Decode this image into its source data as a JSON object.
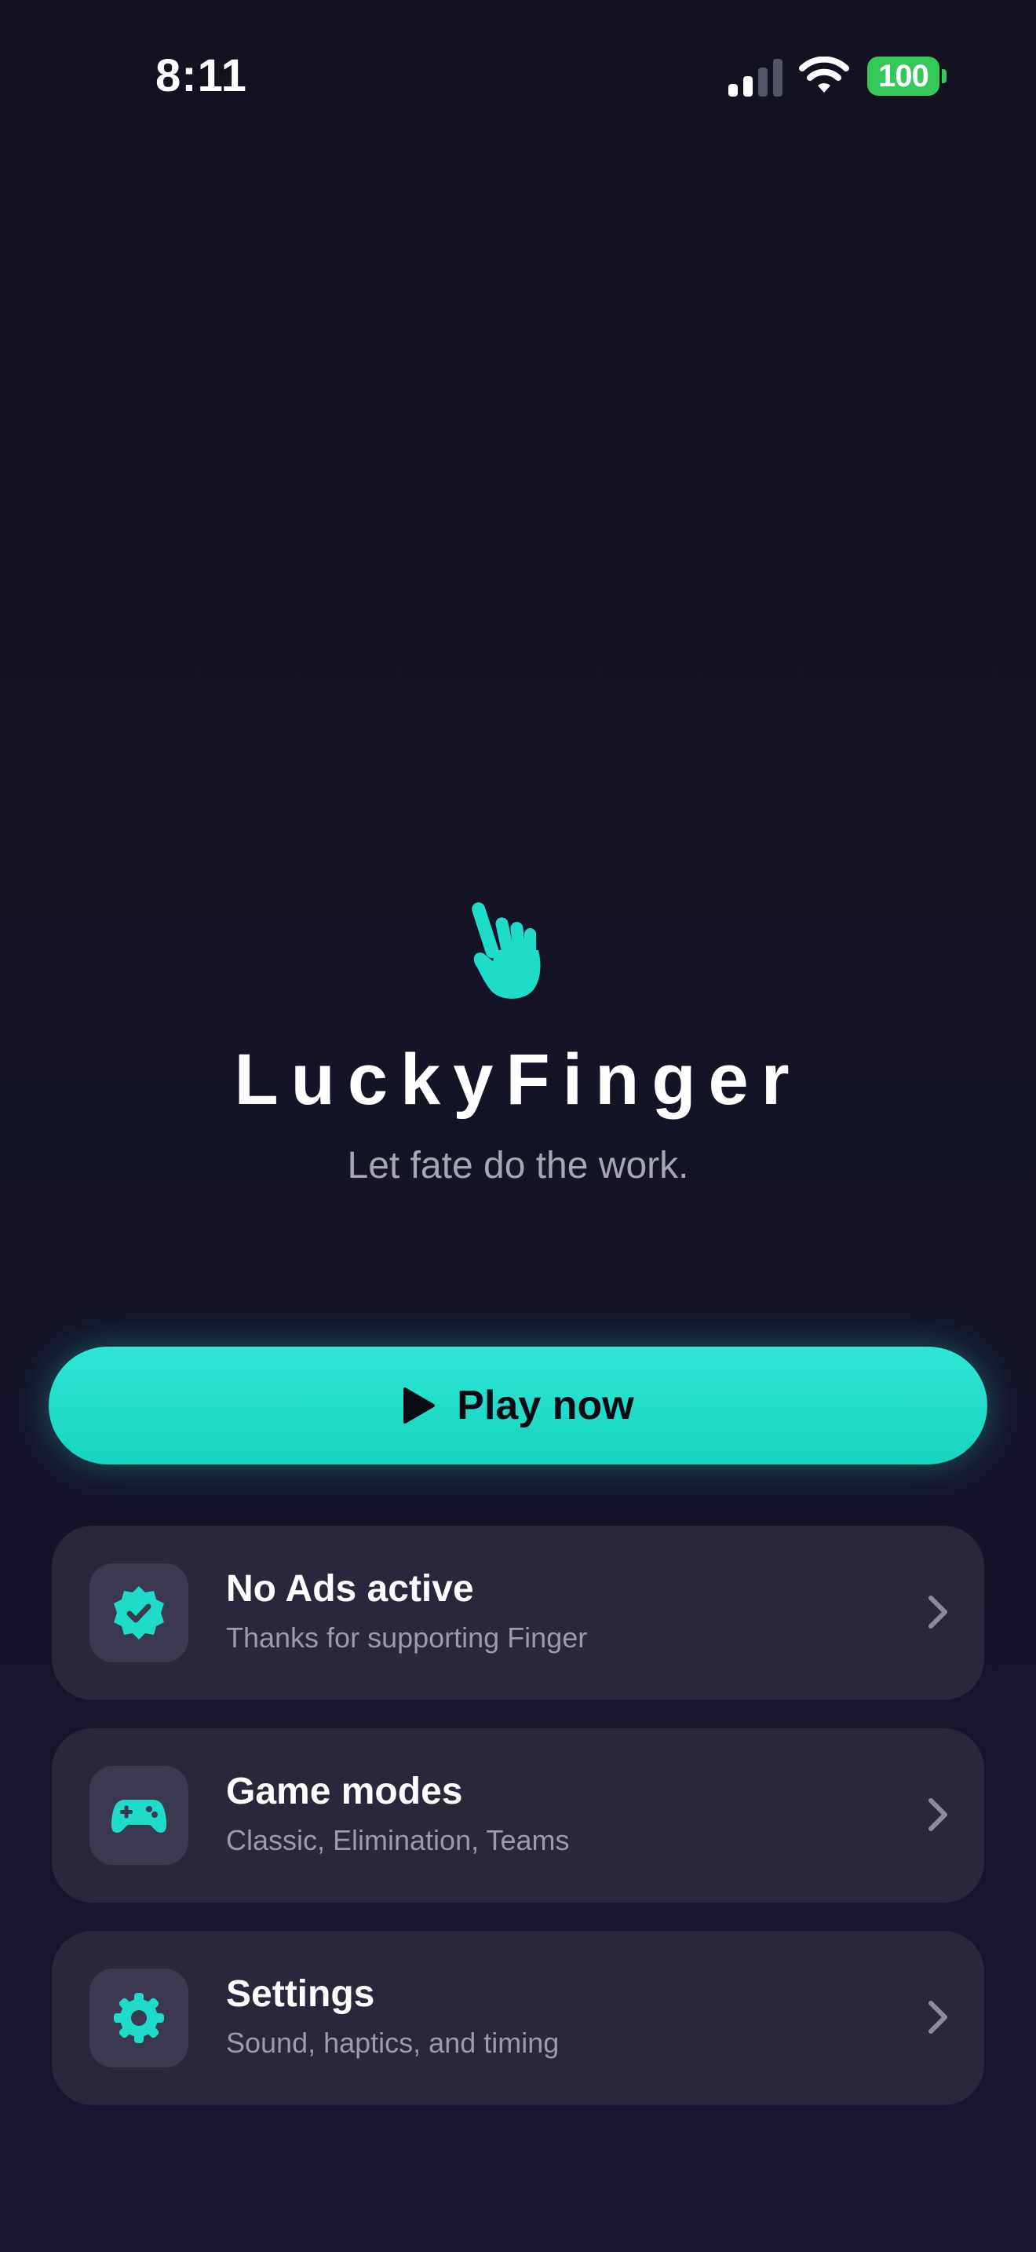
{
  "status_bar": {
    "time": "8:11",
    "battery_level": "100",
    "signal_icon": "cellular-signal-icon",
    "wifi_icon": "wifi-icon"
  },
  "hero": {
    "icon": "pointing-hand-icon",
    "title": "LuckyFinger",
    "tagline": "Let fate do the work."
  },
  "play_button": {
    "label": "Play now",
    "icon": "play-icon"
  },
  "menu": {
    "items": [
      {
        "title": "No Ads active",
        "subtitle": "Thanks for supporting Finger",
        "icon": "verified-badge-icon"
      },
      {
        "title": "Game modes",
        "subtitle": "Classic, Elimination, Teams",
        "icon": "gamepad-icon"
      },
      {
        "title": "Settings",
        "subtitle": "Sound, haptics, and timing",
        "icon": "gear-icon"
      }
    ]
  },
  "colors": {
    "accent": "#1fdcc8",
    "background": "#13131f",
    "card": "#29273c",
    "battery": "#34c759"
  }
}
